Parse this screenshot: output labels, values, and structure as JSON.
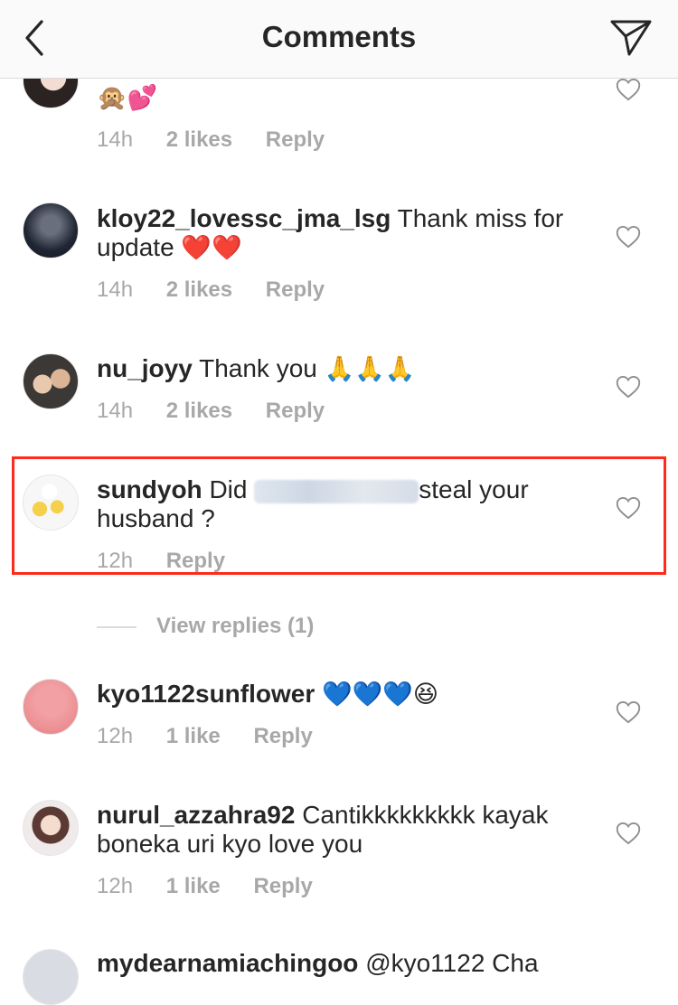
{
  "header": {
    "title": "Comments",
    "back_icon": "chevron-left-icon",
    "share_icon": "send-icon"
  },
  "comments": [
    {
      "user": "",
      "text": "",
      "emojis": "🙊💕",
      "time": "14h",
      "likes": "2 likes",
      "reply": "Reply"
    },
    {
      "user": "kloy22_lovessc_jma_lsg",
      "text": "Thank miss for update",
      "emojis": "❤️❤️",
      "time": "14h",
      "likes": "2 likes",
      "reply": "Reply"
    },
    {
      "user": "nu_joyy",
      "text": "Thank you",
      "emojis": "🙏🙏🙏",
      "time": "14h",
      "likes": "2 likes",
      "reply": "Reply"
    },
    {
      "user": "sundyoh",
      "text": "Did",
      "text_after": "steal your husband ?",
      "time": "12h",
      "reply": "Reply"
    },
    {
      "user": "kyo1122sunflower",
      "text": "",
      "emojis": "💙💙💙😆",
      "time": "12h",
      "likes": "1 like",
      "reply": "Reply"
    },
    {
      "user": "nurul_azzahra92",
      "text": "Cantikkkkkkkkk kayak boneka uri kyo love you",
      "time": "12h",
      "likes": "1 like",
      "reply": "Reply"
    },
    {
      "user": "mydearnamiachingoo",
      "text": "@kyo1122 Cha"
    }
  ],
  "view_replies": "View replies (1)",
  "colors": {
    "highlight": "#ff2a1a",
    "muted": "#a8a8a8",
    "text": "#262626"
  }
}
